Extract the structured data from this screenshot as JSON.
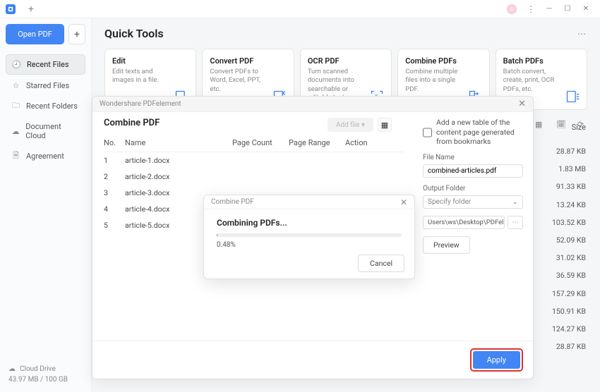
{
  "titlebar": {
    "app": "PDFelement"
  },
  "sidebar": {
    "open_label": "Open PDF",
    "items": [
      {
        "label": "Recent Files",
        "icon": "clock"
      },
      {
        "label": "Starred Files",
        "icon": "star"
      },
      {
        "label": "Recent Folders",
        "icon": "folder"
      },
      {
        "label": "Document Cloud",
        "icon": "cloud"
      },
      {
        "label": "Agreement",
        "icon": "doc"
      }
    ],
    "cloud_label": "Cloud Drive",
    "storage": "43.97 MB / 100 GB"
  },
  "main": {
    "title": "Quick Tools",
    "cards": [
      {
        "title": "Edit",
        "desc": "Edit texts and images in a file."
      },
      {
        "title": "Convert PDF",
        "desc": "Convert PDFs to Word, Excel, PPT, etc."
      },
      {
        "title": "OCR PDF",
        "desc": "Turn scanned documents into searchable or editable text."
      },
      {
        "title": "Combine PDFs",
        "desc": "Combine multiple files into a single PDF."
      },
      {
        "title": "Batch PDFs",
        "desc": "Batch convert, create, print, OCR PDFs, etc."
      }
    ],
    "size_header": "Size",
    "sizes": [
      "28.87 KB",
      "1.83 MB",
      "91.33 KB",
      "13.24 KB",
      "103.52 KB",
      "52.09 KB",
      "31.02 KB",
      "36.59 KB",
      "157.29 KB",
      "150.91 KB",
      "124.27 KB",
      "28.87 KB"
    ]
  },
  "combine": {
    "window_title": "Wondershare PDFelement",
    "heading": "Combine PDF",
    "add_file": "Add file",
    "cols": {
      "no": "No.",
      "name": "Name",
      "page_count": "Page Count",
      "page_range": "Page Range",
      "action": "Action"
    },
    "files": [
      {
        "no": "1",
        "name": "article-1.docx"
      },
      {
        "no": "2",
        "name": "article-2.docx"
      },
      {
        "no": "3",
        "name": "article-3.docx"
      },
      {
        "no": "4",
        "name": "article-4.docx"
      },
      {
        "no": "5",
        "name": "article-5.docx"
      }
    ],
    "toc_checkbox": "Add a new table of the content page generated from bookmarks",
    "filename_label": "File Name",
    "filename_value": "combined-articles.pdf",
    "folder_label": "Output Folder",
    "folder_select": "Specify folder",
    "folder_path": "Users\\ws\\Desktop\\PDFelement\\Com",
    "preview": "Preview",
    "apply": "Apply"
  },
  "progress": {
    "title": "Combine PDF",
    "heading": "Combining PDFs...",
    "percent": "0.48%",
    "cancel": "Cancel"
  }
}
